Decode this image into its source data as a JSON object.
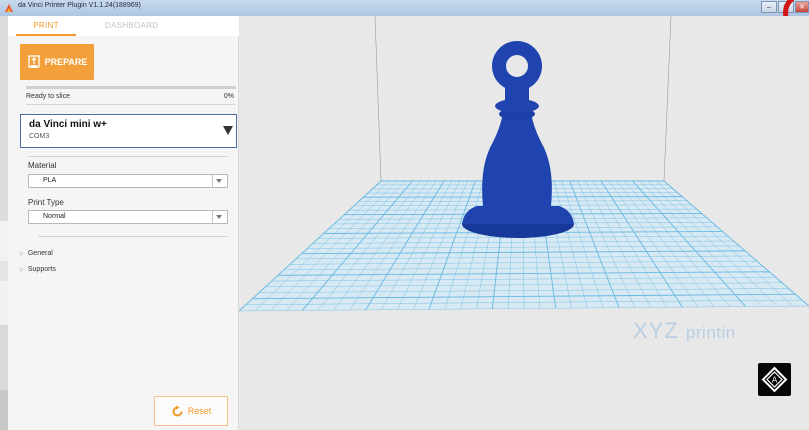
{
  "window": {
    "title": "da Vinci Printer Plugin V1.1.24(188969)",
    "minimize_glyph": "–",
    "maximize_glyph": "□",
    "close_glyph": "✕"
  },
  "tabs": [
    {
      "label": "PRINT",
      "active": true
    },
    {
      "label": "DASHBOARD",
      "active": false
    }
  ],
  "prepare": {
    "label": "PREPARE",
    "icon": "print-icon"
  },
  "progress": {
    "status": "Ready to slice",
    "percent_text": "0%",
    "value": 0
  },
  "printer": {
    "name": "da Vinci mini w+",
    "port": "COM3"
  },
  "material": {
    "label": "Material",
    "value": "PLA"
  },
  "print_type": {
    "label": "Print Type",
    "value": "Normal"
  },
  "tree": [
    {
      "label": "General",
      "expanded": false
    },
    {
      "label": "Supports",
      "expanded": false
    }
  ],
  "reset": {
    "label": "Reset",
    "icon": "refresh-icon"
  },
  "viewport": {
    "brand_main": "XYZ",
    "brand_sub": "printin",
    "ar_icon": "ar-cube-icon"
  },
  "colors": {
    "accent": "#f39a2b",
    "model": "#1f44b0",
    "grid": "#68b8e2"
  }
}
